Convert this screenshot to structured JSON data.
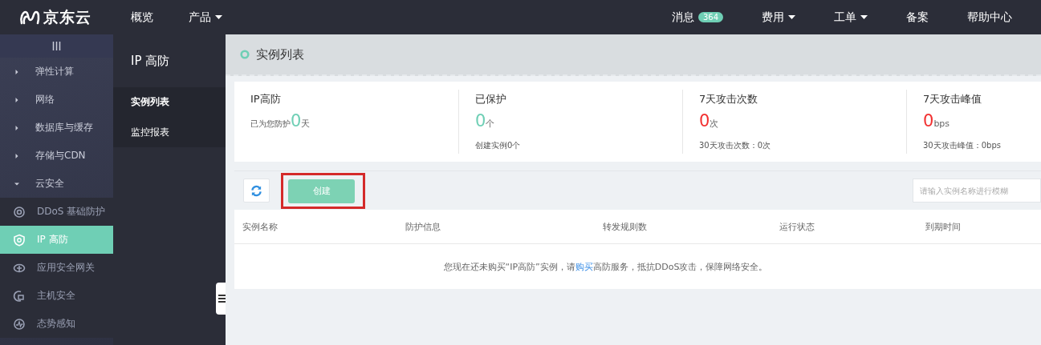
{
  "topbar": {
    "logo": "京东云",
    "nav_left": [
      {
        "label": "概览",
        "dropdown": false
      },
      {
        "label": "产品",
        "dropdown": true
      }
    ],
    "nav_right": [
      {
        "label": "消息",
        "badge": "364",
        "dropdown": false
      },
      {
        "label": "费用",
        "dropdown": true
      },
      {
        "label": "工单",
        "dropdown": true
      },
      {
        "label": "备案",
        "dropdown": false
      },
      {
        "label": "帮助中心",
        "dropdown": false
      }
    ]
  },
  "sidebar": {
    "items": [
      {
        "label": "弹性计算",
        "expanded": false
      },
      {
        "label": "网络",
        "expanded": false
      },
      {
        "label": "数据库与缓存",
        "expanded": false
      },
      {
        "label": "存储与CDN",
        "expanded": false
      },
      {
        "label": "云安全",
        "expanded": true,
        "children": [
          {
            "label": "DDoS 基础防护",
            "selected": false
          },
          {
            "label": "IP 高防",
            "selected": true
          },
          {
            "label": "应用安全网关",
            "selected": false
          },
          {
            "label": "主机安全",
            "selected": false
          },
          {
            "label": "态势感知",
            "selected": false
          }
        ]
      }
    ]
  },
  "subnav": {
    "title": "IP 高防",
    "items": [
      {
        "label": "实例列表",
        "selected": true
      },
      {
        "label": "监控报表",
        "selected": false
      }
    ]
  },
  "page": {
    "title": "实例列表",
    "stats": [
      {
        "kind": "inline",
        "title": "IP高防",
        "prefix": "已为您防护",
        "value": "0",
        "unit": "天",
        "color": "#6fcfb5"
      },
      {
        "kind": "block",
        "title": "已保护",
        "value": "0",
        "unit": "个",
        "note": "创建实例0个",
        "color": "#6fcfb5"
      },
      {
        "kind": "block",
        "title": "7天攻击次数",
        "value": "0",
        "unit": "次",
        "note": "30天攻击次数：0次",
        "color": "#f23030"
      },
      {
        "kind": "block",
        "title": "7天攻击峰值",
        "value": "0",
        "unit": "bps",
        "note": "30天攻击峰值：0bps",
        "color": "#f23030"
      }
    ],
    "create_button": {
      "label": "创建",
      "highlighted": true
    },
    "search": {
      "placeholder": "请输入实例名称进行模糊"
    },
    "table": {
      "columns": [
        "实例名称",
        "防护信息",
        "转发规则数",
        "运行状态",
        "到期时间"
      ],
      "empty_message": {
        "before": "您现在还未购买“IP高防”实例，请",
        "link": "购买",
        "after": "高防服务，抵抗DDoS攻击，保障网络安全。"
      }
    }
  }
}
